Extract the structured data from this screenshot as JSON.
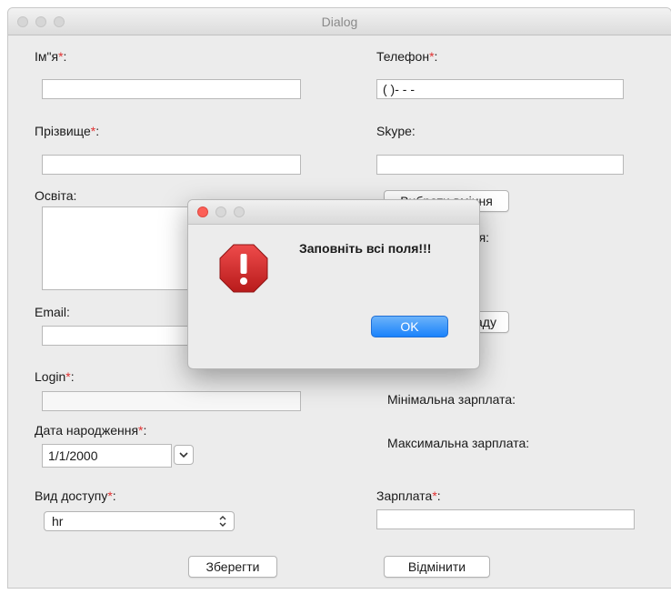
{
  "window": {
    "title": "Dialog"
  },
  "form": {
    "name_label": "Ім\"я",
    "phone_label": "Телефон",
    "phone_value": "( )-  -  -",
    "surname_label": "Прізвище",
    "skype_label": "Skype:",
    "education_label": "Освіта:",
    "choose_skills_button": "Вибрати вміння",
    "partial_label_a": "яя:",
    "partial_button_b": "аду",
    "email_label": "Email:",
    "login_label": "Login",
    "min_salary_label": "Мінімальна зарплата:",
    "max_salary_label": "Максимальна зарплата:",
    "birth_date_label": "Дата народження",
    "birth_date_value": "1/1/2000",
    "access_label": "Вид доступу",
    "access_value": "hr",
    "salary_label": "Зарплата",
    "required_mark": "*",
    "colon": ":",
    "save_button": "Зберегти",
    "cancel_button": "Відмінити"
  },
  "alert": {
    "message": "Заповніть всі поля!!!",
    "ok_button": "OK",
    "icon": "stop-exclamation-icon",
    "colors": {
      "ok": "#1a82fb",
      "stop": "#d22b2b",
      "close": "#fc5f57"
    }
  },
  "colors": {
    "required": "#e03030"
  }
}
